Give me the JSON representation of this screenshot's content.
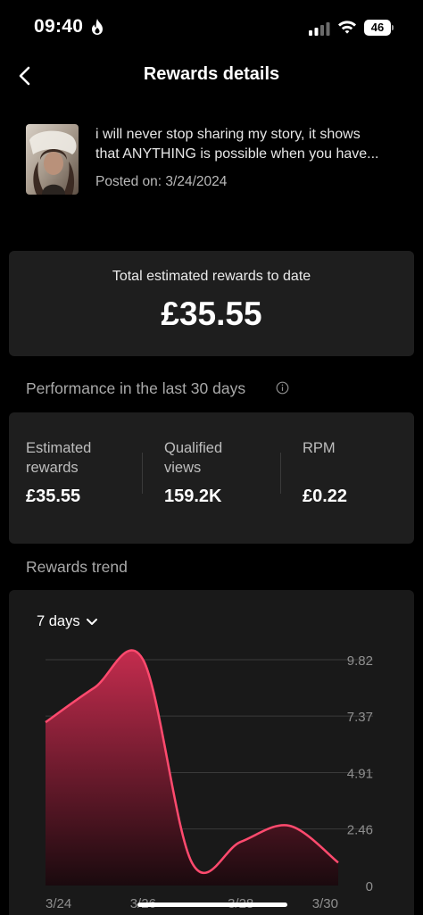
{
  "status_bar": {
    "time": "09:40",
    "battery": "46"
  },
  "nav": {
    "title": "Rewards details",
    "back_icon": "chevron-left-icon"
  },
  "post": {
    "caption_line1": "i will never stop sharing my story, it shows",
    "caption_line2": "that ANYTHING is possible when you have...",
    "posted_on": "Posted on: 3/24/2024"
  },
  "total": {
    "label": "Total estimated rewards to date",
    "value": "£35.55"
  },
  "performance": {
    "title": "Performance in the last 30 days",
    "metrics": [
      {
        "label_line1": "Estimated",
        "label_line2": "rewards",
        "value": "£35.55"
      },
      {
        "label_line1": "Qualified",
        "label_line2": "views",
        "value": "159.2K"
      },
      {
        "label_line1": "RPM",
        "label_line2": "",
        "value": "£0.22"
      }
    ]
  },
  "trend": {
    "title": "Rewards trend",
    "range": "7 days"
  },
  "chart_data": {
    "type": "area",
    "x": [
      "3/24",
      "3/25",
      "3/26",
      "3/27",
      "3/28",
      "3/29",
      "3/30"
    ],
    "values": [
      7.1,
      8.6,
      9.82,
      1.0,
      1.9,
      2.6,
      1.0
    ],
    "y_ticks": [
      "9.82",
      "7.37",
      "4.91",
      "2.46",
      "0"
    ],
    "x_tick_labels": [
      "3/24",
      "3/26",
      "3/28",
      "3/30"
    ],
    "ylim": [
      0,
      9.82
    ],
    "grid": true,
    "colors": {
      "line": "#ff4a6e",
      "fill_top": "#c42c4e",
      "fill_bottom": "#1a0a0e"
    }
  }
}
